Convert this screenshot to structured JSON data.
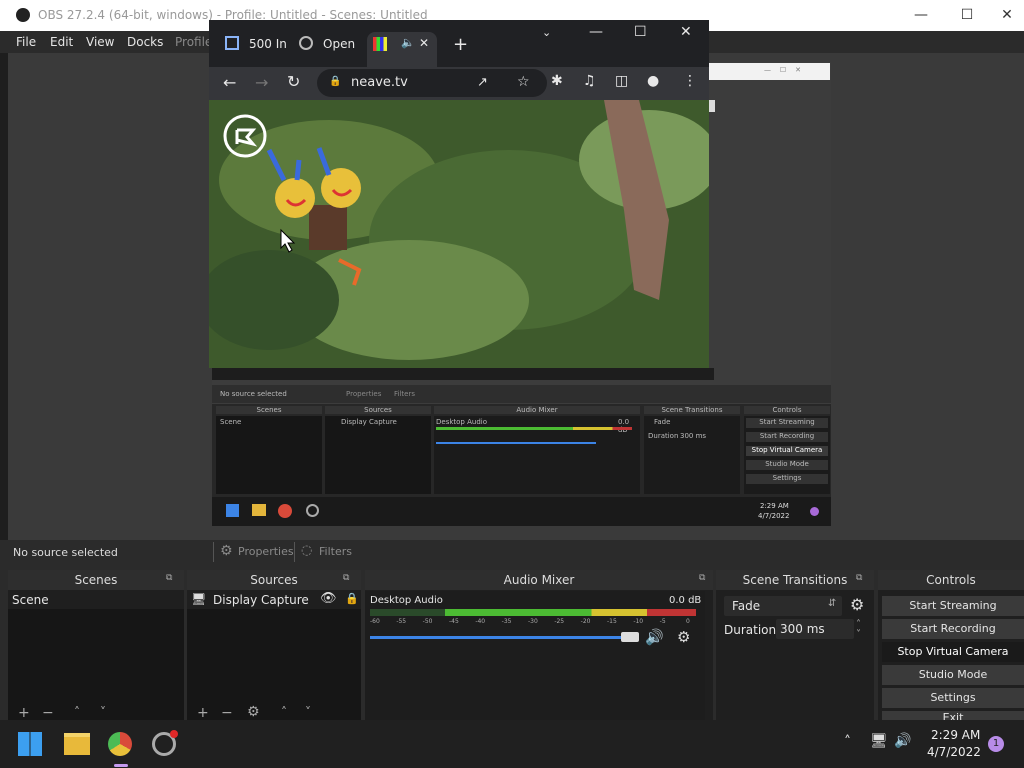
{
  "obs": {
    "window_title": "OBS 27.2.4 (64-bit, windows) - Profile: Untitled - Scenes: Untitled",
    "menu": [
      "File",
      "Edit",
      "View",
      "Docks",
      "Profile"
    ],
    "status_text": "No source selected",
    "properties_label": "Properties",
    "filters_label": "Filters",
    "docks": {
      "scenes_title": "Scenes",
      "sources_title": "Sources",
      "mixer_title": "Audio Mixer",
      "transitions_title": "Scene Transitions",
      "controls_title": "Controls"
    },
    "scenes": [
      "Scene"
    ],
    "sources": [
      "Display Capture"
    ],
    "mixer": {
      "track": "Desktop Audio",
      "db": "0.0 dB",
      "ticks": [
        "-60",
        "-55",
        "-50",
        "-45",
        "-40",
        "-35",
        "-30",
        "-25",
        "-20",
        "-15",
        "-10",
        "-5",
        "0"
      ]
    },
    "transitions": {
      "selected": "Fade",
      "duration_label": "Duration",
      "duration_value": "300 ms"
    },
    "controls": [
      "Start Streaming",
      "Start Recording",
      "Stop Virtual Camera",
      "Studio Mode",
      "Settings",
      "Exit"
    ]
  },
  "nested": {
    "status_text": "No source selected",
    "properties_label": "Properties",
    "filters_label": "Filters",
    "scenes_title": "Scenes",
    "sources_title": "Sources",
    "mixer_title": "Audio Mixer",
    "transitions_title": "Scene Transitions",
    "controls_title": "Controls",
    "scene": "Scene",
    "source": "Display Capture",
    "track": "Desktop Audio",
    "db": "0.0 dB",
    "transition": "Fade",
    "duration_label": "Duration",
    "duration_value": "300 ms",
    "controls": [
      "Start Streaming",
      "Start Recording",
      "Stop Virtual Camera",
      "Studio Mode",
      "Settings"
    ],
    "time": "2:29 AM",
    "date": "4/7/2022"
  },
  "browser": {
    "tab1": "500 In",
    "tab2": "Open",
    "url": "neave.tv"
  },
  "taskbar": {
    "time": "2:29 AM",
    "date": "4/7/2022",
    "badge": "1"
  },
  "colors": {
    "accent_blue": "#3c84e6",
    "meter_green": "#4cbb33",
    "meter_yellow": "#d6c230",
    "meter_red": "#c03434"
  }
}
